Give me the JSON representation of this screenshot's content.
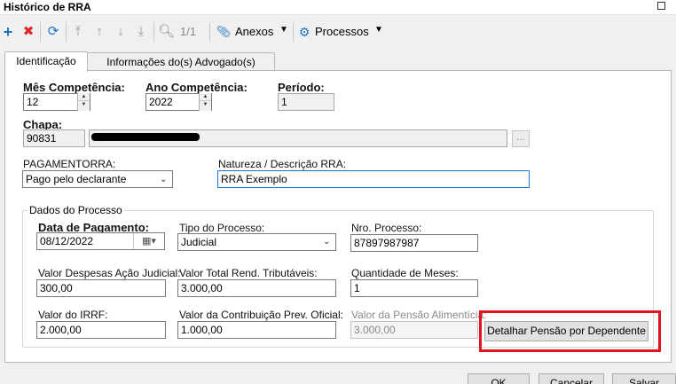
{
  "window": {
    "title": "Histórico de RRA"
  },
  "toolbar": {
    "page_indicator": "1/1",
    "anexos_label": "Anexos",
    "processos_label": "Processos"
  },
  "tabs": [
    {
      "label": "Identificação",
      "active": true
    },
    {
      "label": "Informações do(s) Advogado(s)",
      "active": false
    }
  ],
  "form": {
    "mes_competencia": {
      "label": "Mês Competência:",
      "value": "12"
    },
    "ano_competencia": {
      "label": "Ano Competência:",
      "value": "2022"
    },
    "periodo": {
      "label": "Período:",
      "value": "1"
    },
    "chapa": {
      "label": "Chapa:",
      "value": "90831",
      "lookup_label": "..."
    },
    "pagamento_rra": {
      "label": "PAGAMENTORRA:",
      "value": "Pago pelo declarante"
    },
    "natureza": {
      "label": "Natureza / Descrição RRA:",
      "value": "RRA Exemplo"
    }
  },
  "dados_processo": {
    "title": "Dados do Processo",
    "data_pagamento": {
      "label": "Data de Pagamento:",
      "value": "08/12/2022"
    },
    "tipo_processo": {
      "label": "Tipo do Processo:",
      "value": "Judicial"
    },
    "nro_processo": {
      "label": "Nro. Processo:",
      "value": "87897987987"
    },
    "valor_despesas": {
      "label": "Valor Despesas Ação Judicial:",
      "value": "300,00"
    },
    "valor_total_rend": {
      "label": "Valor Total Rend. Tributáveis:",
      "value": "3.000,00"
    },
    "quantidade_meses": {
      "label": "Quantidade de Meses:",
      "value": "1"
    },
    "valor_irrf": {
      "label": "Valor do IRRF:",
      "value": "2.000,00"
    },
    "valor_contribuicao": {
      "label": "Valor da Contribuição Prev. Oficial:",
      "value": "1.000,00"
    },
    "valor_pensao": {
      "label": "Valor da Pensão Alimentícia:",
      "value": "3.000,00"
    },
    "detalhar_button": "Detalhar Pensão por Dependente"
  },
  "footer": {
    "ok_label": "OK",
    "cancel_label": "Cancelar",
    "save_label": "Salvar"
  },
  "colors": {
    "highlight": "#e0141e",
    "add_icon": "#1e73be",
    "delete_icon": "#d9262c",
    "focus_border": "#1e7ad3"
  }
}
